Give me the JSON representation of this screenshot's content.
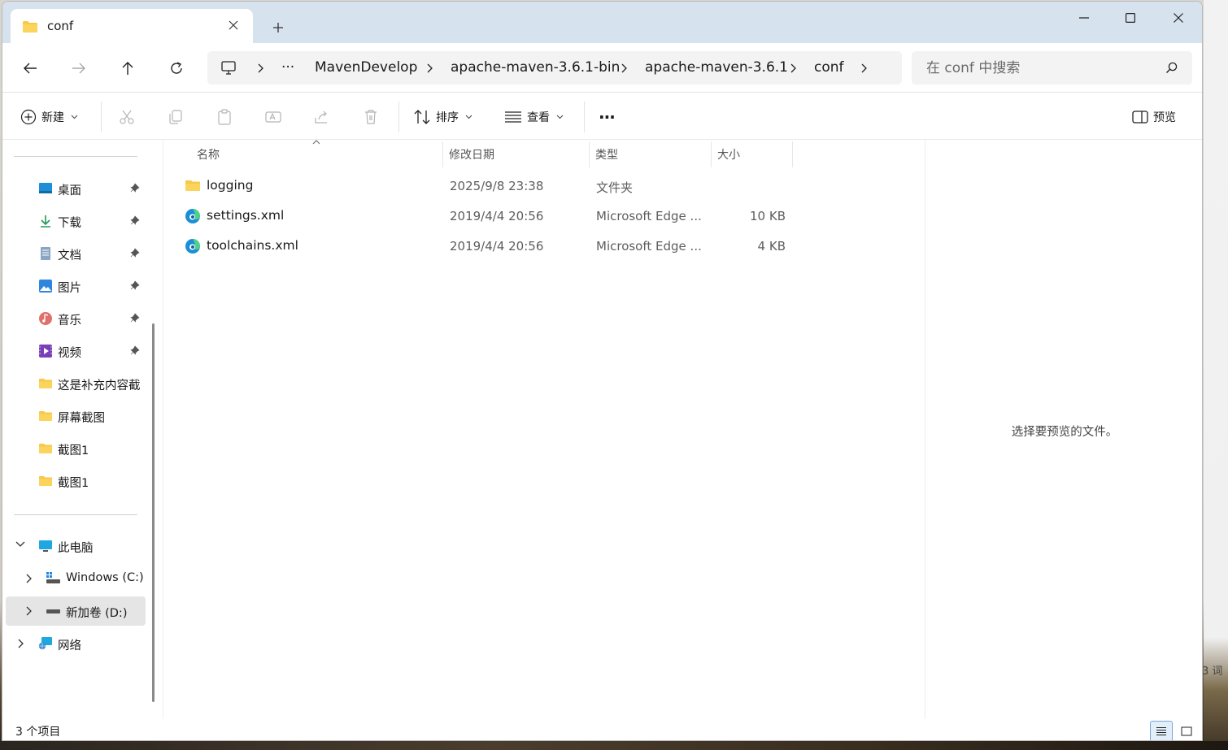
{
  "window": {
    "tab_title": "conf",
    "minimize_glyph": "—",
    "maximize_glyph": "☐",
    "close_glyph": "✕"
  },
  "nav": {
    "breadcrumb": [
      "MavenDevelop",
      "apache-maven-3.6.1-bin",
      "apache-maven-3.6.1",
      "conf"
    ],
    "overflow_label": "···",
    "search_placeholder": "在 conf 中搜索"
  },
  "toolbar": {
    "new_label": "新建",
    "sort_label": "排序",
    "view_label": "查看",
    "more_label": "···",
    "preview_label": "预览"
  },
  "sidebar": {
    "quick_access": [
      {
        "label": "桌面",
        "icon": "desktop-icon",
        "pinned": true
      },
      {
        "label": "下载",
        "icon": "download-icon",
        "pinned": true
      },
      {
        "label": "文档",
        "icon": "document-icon",
        "pinned": true
      },
      {
        "label": "图片",
        "icon": "pictures-icon",
        "pinned": true
      },
      {
        "label": "音乐",
        "icon": "music-icon",
        "pinned": true
      },
      {
        "label": "视频",
        "icon": "video-icon",
        "pinned": true
      },
      {
        "label": "这是补充内容截",
        "icon": "folder-icon",
        "pinned": false
      },
      {
        "label": "屏幕截图",
        "icon": "folder-icon",
        "pinned": false
      },
      {
        "label": "截图1",
        "icon": "folder-icon",
        "pinned": false
      },
      {
        "label": "截图1",
        "icon": "folder-icon",
        "pinned": false
      }
    ],
    "this_pc": "此电脑",
    "drives": [
      {
        "label": "Windows (C:)",
        "selected": false
      },
      {
        "label": "新加卷 (D:)",
        "selected": true
      }
    ],
    "network": "网络"
  },
  "columns": {
    "name": "名称",
    "date": "修改日期",
    "type": "类型",
    "size": "大小"
  },
  "files": [
    {
      "name": "logging",
      "date": "2025/9/8 23:38",
      "type": "文件夹",
      "size": "",
      "icon": "folder-icon"
    },
    {
      "name": "settings.xml",
      "date": "2019/4/4 20:56",
      "type": "Microsoft Edge ...",
      "size": "10 KB",
      "icon": "edge-icon"
    },
    {
      "name": "toolchains.xml",
      "date": "2019/4/4 20:56",
      "type": "Microsoft Edge ...",
      "size": "4 KB",
      "icon": "edge-icon"
    }
  ],
  "preview": {
    "message": "选择要预览的文件。"
  },
  "status": {
    "item_count": "3 个项目"
  },
  "desktop": {
    "peek_text": "3 词"
  },
  "colors": {
    "titlebar": "#d6e2ee",
    "folder": "#f7c948",
    "accent": "#0067c0",
    "selected_row": "#e5e5e5"
  }
}
